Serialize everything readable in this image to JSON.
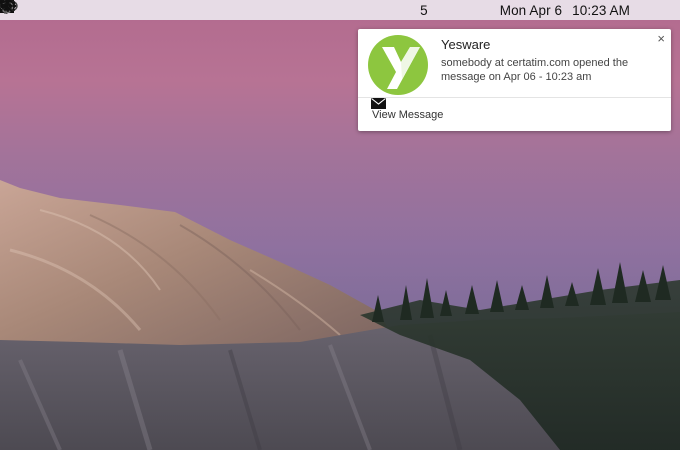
{
  "menubar": {
    "items": [
      {
        "icon": "bell-icon"
      },
      {
        "icon": "send-arrow-icon"
      },
      {
        "icon": "circle-o-icon"
      },
      {
        "icon": "dropbox-icon"
      },
      {
        "icon": "drive-icon"
      },
      {
        "icon": "adobe-icon",
        "badge": "5"
      },
      {
        "icon": "creative-cloud-icon"
      },
      {
        "icon": "time-machine-icon"
      },
      {
        "icon": "bluetooth-icon"
      },
      {
        "icon": "wifi-icon"
      },
      {
        "icon": "volume-icon"
      }
    ],
    "adobe_count": "5",
    "date": "Mon Apr 6",
    "time": "10:23 AM",
    "search_icon": "search-icon",
    "list_icon": "notification-center-icon"
  },
  "notification": {
    "app_name": "Yesware",
    "message": "somebody at certatim.com opened the message on Apr 06 - 10:23 am",
    "close_label": "×",
    "action_label": "View Message",
    "action_icon": "envelope-icon",
    "logo_icon": "yesware-logo",
    "brand_color": "#8dc63f"
  },
  "wallpaper": {
    "sky_color": "#b26a8e",
    "rock_color": "#9c8477"
  }
}
